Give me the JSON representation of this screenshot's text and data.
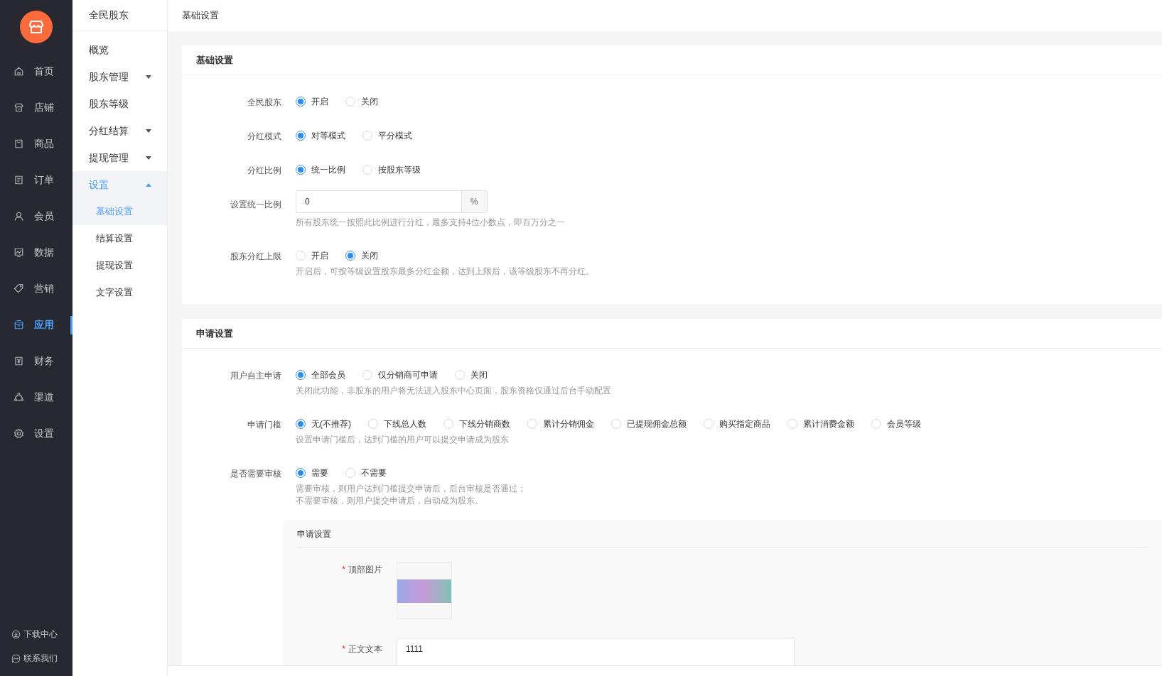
{
  "nav": {
    "items": [
      {
        "label": "首页",
        "selected": false
      },
      {
        "label": "店铺",
        "selected": false
      },
      {
        "label": "商品",
        "selected": false
      },
      {
        "label": "订单",
        "selected": false
      },
      {
        "label": "会员",
        "selected": false
      },
      {
        "label": "数据",
        "selected": false
      },
      {
        "label": "营销",
        "selected": false
      },
      {
        "label": "应用",
        "selected": true
      },
      {
        "label": "财务",
        "selected": false
      },
      {
        "label": "渠道",
        "selected": false
      },
      {
        "label": "设置",
        "selected": false
      }
    ],
    "footer": [
      {
        "label": "下载中心"
      },
      {
        "label": "联系我们"
      }
    ]
  },
  "subnav": {
    "title": "全民股东",
    "items": [
      {
        "label": "概览",
        "kind": "link",
        "selected": false
      },
      {
        "label": "股东管理",
        "kind": "group",
        "expanded": false,
        "selected": false
      },
      {
        "label": "股东等级",
        "kind": "link",
        "selected": false
      },
      {
        "label": "分红结算",
        "kind": "group",
        "expanded": false,
        "selected": false
      },
      {
        "label": "提现管理",
        "kind": "group",
        "expanded": false,
        "selected": false
      },
      {
        "label": "设置",
        "kind": "group",
        "expanded": true,
        "selected": true,
        "children": [
          {
            "label": "基础设置",
            "selected": true
          },
          {
            "label": "结算设置",
            "selected": false
          },
          {
            "label": "提现设置",
            "selected": false
          },
          {
            "label": "文字设置",
            "selected": false
          }
        ]
      }
    ]
  },
  "page_title": "基础设置",
  "sections": [
    {
      "title": "基础设置",
      "fields": [
        {
          "kind": "radio",
          "label": "全民股东",
          "options": [
            {
              "label": "开启",
              "selected": true
            },
            {
              "label": "关闭",
              "selected": false
            }
          ]
        },
        {
          "kind": "radio",
          "label": "分红模式",
          "options": [
            {
              "label": "对等模式",
              "selected": true
            },
            {
              "label": "平分模式",
              "selected": false
            }
          ]
        },
        {
          "kind": "radio",
          "label": "分红比例",
          "options": [
            {
              "label": "统一比例",
              "selected": true
            },
            {
              "label": "按股东等级",
              "selected": false
            }
          ]
        },
        {
          "kind": "input",
          "label": "设置统一比例",
          "value": "0",
          "suffix": "%",
          "hints": [
            "所有股东统一按照此比例进行分红，最多支持4位小数点，即百万分之一"
          ]
        },
        {
          "kind": "radio",
          "label": "股东分红上限",
          "options": [
            {
              "label": "开启",
              "selected": false
            },
            {
              "label": "关闭",
              "selected": true
            }
          ],
          "hints": [
            "开启后，可按等级设置股东最多分红金额，达到上限后，该等级股东不再分红。"
          ]
        }
      ]
    },
    {
      "title": "申请设置",
      "fields": [
        {
          "kind": "radio",
          "label": "用户自主申请",
          "options": [
            {
              "label": "全部会员",
              "selected": true
            },
            {
              "label": "仅分销商可申请",
              "selected": false
            },
            {
              "label": "关闭",
              "selected": false
            }
          ],
          "hints": [
            "关闭此功能，非股东的用户将无法进入股东中心页面，股东资格仅通过后台手动配置"
          ]
        },
        {
          "kind": "radio",
          "label": "申请门槛",
          "options": [
            {
              "label": "无(不推荐)",
              "selected": true
            },
            {
              "label": "下线总人数",
              "selected": false
            },
            {
              "label": "下线分销商数",
              "selected": false
            },
            {
              "label": "累计分销佣金",
              "selected": false
            },
            {
              "label": "已提现佣金总额",
              "selected": false
            },
            {
              "label": "购买指定商品",
              "selected": false
            },
            {
              "label": "累计消费金额",
              "selected": false
            },
            {
              "label": "会员等级",
              "selected": false
            }
          ],
          "hints": [
            "设置申请门槛后，达到门槛的用户可以提交申请成为股东"
          ]
        },
        {
          "kind": "radio",
          "label": "是否需要审核",
          "options": [
            {
              "label": "需要",
              "selected": true
            },
            {
              "label": "不需要",
              "selected": false
            }
          ],
          "hints": [
            "需要审核，则用户达到门槛提交申请后，后台审核是否通过；",
            "不需要审核，则用户提交申请后，自动成为股东。"
          ]
        }
      ],
      "panel": {
        "title": "申请设置",
        "fields": [
          {
            "kind": "image",
            "label": "顶部图片",
            "required_mark": "*"
          },
          {
            "kind": "textarea",
            "label": "正文文本",
            "required_mark": "*",
            "value": "1111"
          }
        ]
      }
    }
  ]
}
